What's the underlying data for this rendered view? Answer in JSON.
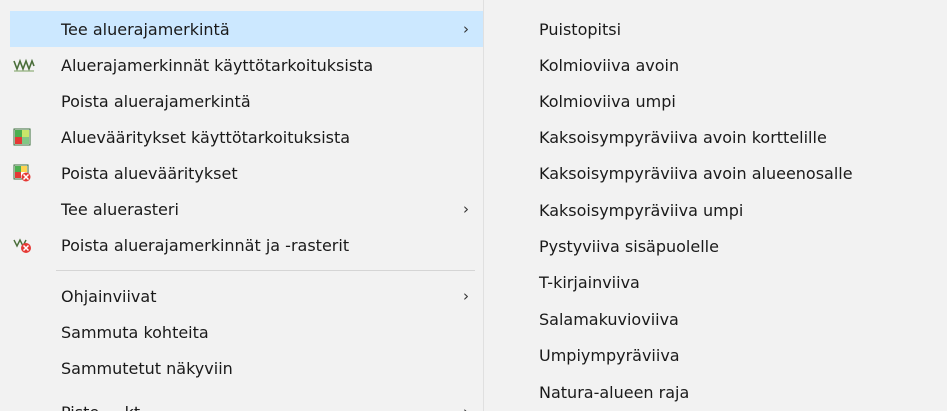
{
  "main_menu": {
    "items": [
      {
        "label": "Tee aluerajamerkintä",
        "submenu": "›"
      },
      {
        "label": "Aluerajamerkinnät käyttötarkoituksista",
        "icon": "zigzag-border-icon"
      },
      {
        "label": "Poista aluerajamerkintä"
      },
      {
        "label": "Aluevääritykset käyttötarkoituksista",
        "icon": "colored-area-icon"
      },
      {
        "label": "Poista aluevääritykset",
        "icon": "remove-coloring-icon"
      },
      {
        "label": "Tee aluerasteri",
        "submenu": "›"
      },
      {
        "label": "Poista aluerajamerkinnät ja -rasterit",
        "icon": "remove-markings-icon"
      },
      {
        "label": "Ohjainviivat",
        "submenu": "›"
      },
      {
        "label": "Sammuta kohteita"
      },
      {
        "label": "Sammutetut näkyviin"
      },
      {
        "label": "Piste ... kt",
        "submenu": "›"
      }
    ]
  },
  "submenu": {
    "items": [
      "Puistopitsi",
      "Kolmioviiva avoin",
      "Kolmioviiva umpi",
      "Kaksoisympyräviiva avoin korttelille",
      "Kaksoisympyräviiva avoin alueenosalle",
      "Kaksoisympyräviiva umpi",
      "Pystyviiva sisäpuolelle",
      "T-kirjainviiva",
      "Salamakuvioviiva",
      "Umpiympyräviiva",
      "Natura-alueen raja"
    ]
  },
  "colors": {
    "menu_bg": "#f2f2f2",
    "highlight": "#cce8ff",
    "separator": "#d5d5d5"
  }
}
